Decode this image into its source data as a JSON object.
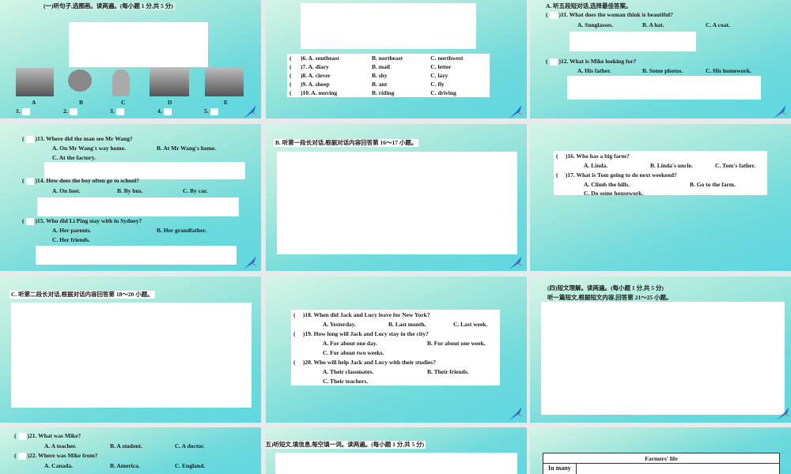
{
  "s1": {
    "title": "(一)听句子,选图画。读两遍。(每小题 1 分,共 5 分)",
    "pictures": [
      "A",
      "B",
      "C",
      "D",
      "E"
    ],
    "blanks": [
      "1.",
      "2.",
      "3.",
      "4.",
      "5."
    ]
  },
  "s2": {
    "rows": [
      {
        "q": ")6. A. southeast",
        "b": "B. northeast",
        "c": "C. northwest"
      },
      {
        "q": ")7. A. diary",
        "b": "B. mail",
        "c": "C. letter"
      },
      {
        "q": ")8. A. clever",
        "b": "B. shy",
        "c": "C. lazy"
      },
      {
        "q": ")9. A. sheep",
        "b": "B. ant",
        "c": "C. fly"
      },
      {
        "q": ")10. A. moving",
        "b": "B. riding",
        "c": "C. driving"
      }
    ]
  },
  "s3": {
    "heading": "A. 听五段短对话,选择最佳答案。",
    "q11": ")11. What does the woman think is beautiful?",
    "q11a": "A. Sunglasses.",
    "q11b": "B. A hat.",
    "q11c": "C. A coat.",
    "q12": ")12. What is Mike looking for?",
    "q12a": "A. His father.",
    "q12b": "B. Some photos.",
    "q12c": "C. His homework."
  },
  "s4": {
    "q13": ")13. Where did the man see Mr Wang?",
    "q13a": "A. On Mr Wang's way home.",
    "q13b": "B. At Mr Wang's home.",
    "q13c": "C. At the factory.",
    "q14": ")14. How does the boy often go to school?",
    "q14a": "A. On foot.",
    "q14b": "B. By bus.",
    "q14c": "C. By car.",
    "q15": ")15. Who did Li Ping stay with in Sydney?",
    "q15a": "A. Her parents.",
    "q15b": "B. Her grandfather.",
    "q15c": "C. Her friends."
  },
  "s5": {
    "heading": "B. 听第一段长对话,根据对话内容回答第 16～17 小题。"
  },
  "s6": {
    "q16": ")16. Who has a big farm?",
    "q16a": "A. Linda.",
    "q16b": "B. Linda's uncle.",
    "q16c": "C. Tom's father.",
    "q17": ")17. What is Tom going to do next weekend?",
    "q17a": "A. Climb the hills.",
    "q17b": "B. Go to the farm.",
    "q17c": "C. Do some housework."
  },
  "s7": {
    "heading": "C. 听第二段长对话,根据对话内容回答第 18～20 小题。"
  },
  "s8": {
    "q18": ")18. When did Jack and Lucy leave for New York?",
    "q18a": "A. Yesterday.",
    "q18b": "B. Last month.",
    "q18c": "C. Last week.",
    "q19": ")19. How long will Jack and Lucy stay in the city?",
    "q19a": "A. For about one day.",
    "q19b": "B. For about one week.",
    "q19c": "C. For about two weeks.",
    "q20": ")20. Who will help Jack and Lucy with their studies?",
    "q20a": "A. Their classmates.",
    "q20b": "B. Their friends.",
    "q20c": "C. Their teachers."
  },
  "s9": {
    "heading1": "(四)短文理解。读两遍。(每小题 1 分,共 5 分)",
    "heading2": "听一篇短文,根据短文内容,回答第 21～25 小题。"
  },
  "s10": {
    "q21": ")21. What was Mike?",
    "q21a": "A. A teacher.",
    "q21b": "B. A student.",
    "q21c": "C. A doctor.",
    "q22": ")22. Where was Mike from?",
    "q22a": "A. Canada.",
    "q22b": "B. America.",
    "q22c": "C. England."
  },
  "s11": {
    "heading": "(五)听短文,填信息,每空填一词。读两遍。(每小题 1 分,共 5 分)"
  },
  "s12": {
    "table_title": "Farmers' life",
    "row1": "In many"
  }
}
